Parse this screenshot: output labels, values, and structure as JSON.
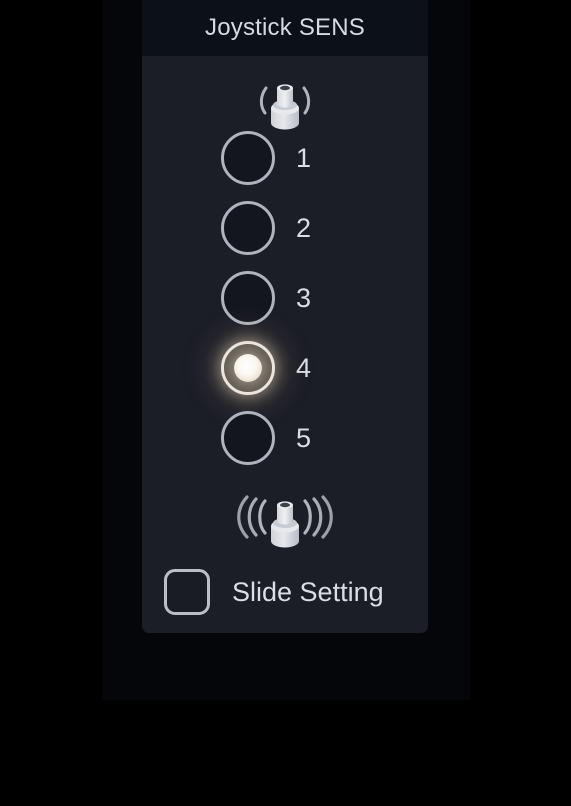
{
  "panel": {
    "title": "Joystick SENS",
    "icons": {
      "low_sensitivity": "joystick-low-sensitivity-icon",
      "high_sensitivity": "joystick-high-sensitivity-icon"
    },
    "options": [
      {
        "label": "1",
        "value": 1,
        "selected": false
      },
      {
        "label": "2",
        "value": 2,
        "selected": false
      },
      {
        "label": "3",
        "value": 3,
        "selected": false
      },
      {
        "label": "4",
        "value": 4,
        "selected": true
      },
      {
        "label": "5",
        "value": 5,
        "selected": false
      }
    ],
    "selected_value": "4",
    "slide_setting": {
      "label": "Slide Setting",
      "checked": false
    }
  },
  "colors": {
    "page_background": "#000000",
    "backdrop": "#050609",
    "panel_background": "#1b1d27",
    "header_background": "#0c1018",
    "text": "#d9dde5",
    "control_outline": "#aeb3bd",
    "selected_glow": "#ecd6b0",
    "selected_dot": "#ffffff"
  }
}
